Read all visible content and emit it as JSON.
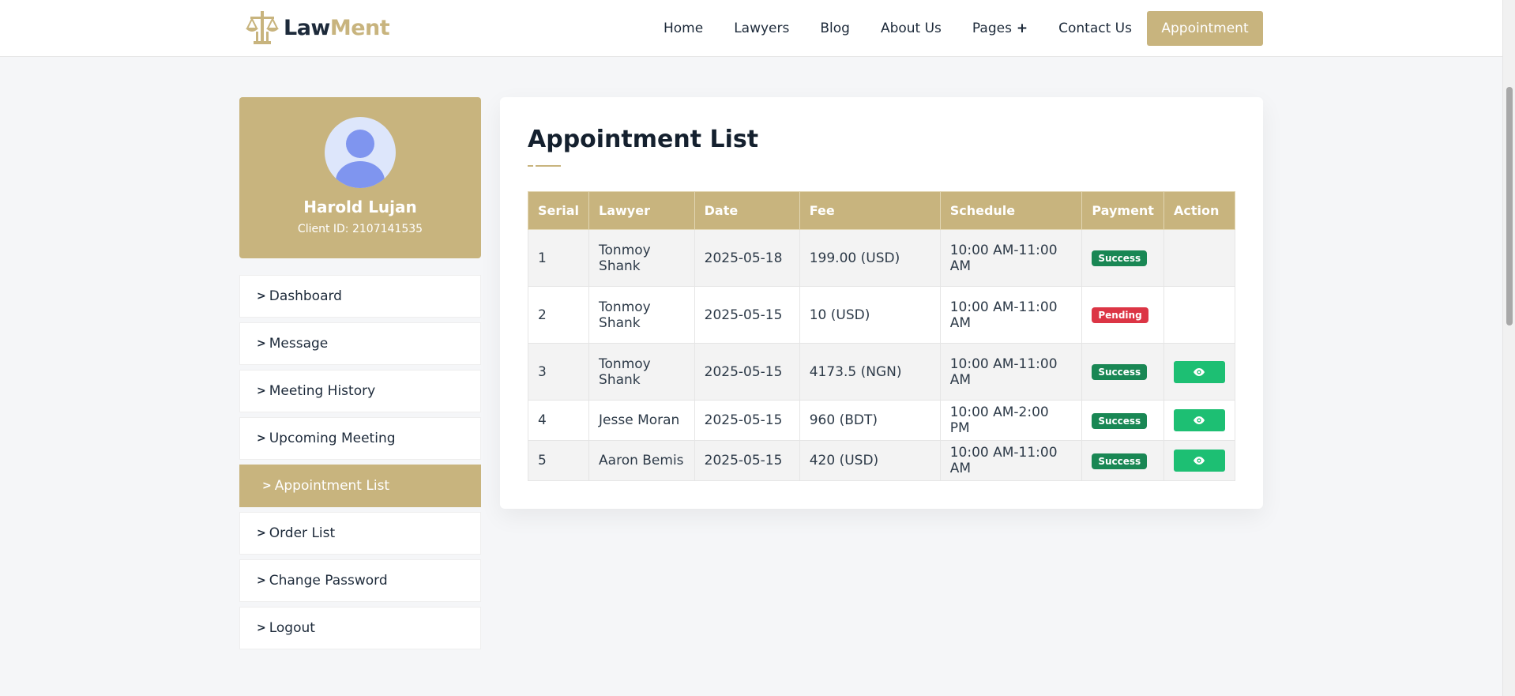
{
  "header": {
    "logo": {
      "part1": "Law",
      "part2": "Ment"
    },
    "nav": [
      {
        "label": "Home"
      },
      {
        "label": "Lawyers"
      },
      {
        "label": "Blog"
      },
      {
        "label": "About Us"
      },
      {
        "label": "Pages"
      },
      {
        "label": "Contact Us"
      }
    ],
    "cta": "Appointment"
  },
  "profile": {
    "name": "Harold Lujan",
    "client_id": "Client ID: 2107141535"
  },
  "sidebar": {
    "items": [
      {
        "label": "Dashboard"
      },
      {
        "label": "Message"
      },
      {
        "label": "Meeting History"
      },
      {
        "label": "Upcoming Meeting"
      },
      {
        "label": "Appointment List",
        "active": true
      },
      {
        "label": "Order List"
      },
      {
        "label": "Change Password"
      },
      {
        "label": "Logout"
      }
    ]
  },
  "main": {
    "title": "Appointment List",
    "table": {
      "headers": [
        "Serial",
        "Lawyer",
        "Date",
        "Fee",
        "Schedule",
        "Payment",
        "Action"
      ],
      "rows": [
        {
          "serial": "1",
          "lawyer": "Tonmoy Shank",
          "date": "2025-05-18",
          "fee": "199.00 (USD)",
          "schedule": "10:00 AM-11:00 AM",
          "payment": "Success",
          "action": ""
        },
        {
          "serial": "2",
          "lawyer": "Tonmoy Shank",
          "date": "2025-05-15",
          "fee": "10 (USD)",
          "schedule": "10:00 AM-11:00 AM",
          "payment": "Pending",
          "action": ""
        },
        {
          "serial": "3",
          "lawyer": "Tonmoy Shank",
          "date": "2025-05-15",
          "fee": "4173.5 (NGN)",
          "schedule": "10:00 AM-11:00 AM",
          "payment": "Success",
          "action": "eye-icon"
        },
        {
          "serial": "4",
          "lawyer": "Jesse Moran",
          "date": "2025-05-15",
          "fee": "960 (BDT)",
          "schedule": "10:00 AM-2:00 PM",
          "payment": "Success",
          "action": "eye-icon"
        },
        {
          "serial": "5",
          "lawyer": "Aaron Bemis",
          "date": "2025-05-15",
          "fee": "420 (USD)",
          "schedule": "10:00 AM-11:00 AM",
          "payment": "Success",
          "action": "eye-icon"
        }
      ]
    }
  },
  "colors": {
    "accent": "#c8b47e",
    "success": "#198754",
    "pending": "#dc3545",
    "view_button": "#1dbf73"
  }
}
